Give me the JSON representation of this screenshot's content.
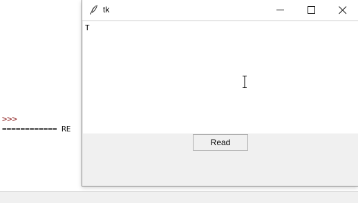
{
  "shell": {
    "prompt": ">>>",
    "restart_line": "============ RE"
  },
  "window": {
    "title": "tk",
    "icon": "feather-icon",
    "controls": {
      "minimize_icon": "minimize-icon",
      "maximize_icon": "maximize-icon",
      "close_icon": "close-icon"
    }
  },
  "editor": {
    "content": "T"
  },
  "read_button": {
    "label": "Read"
  },
  "colors": {
    "prompt": "#8b1a1a",
    "window_bg": "#f0f0f0",
    "titlebar_bg": "#ffffff"
  }
}
